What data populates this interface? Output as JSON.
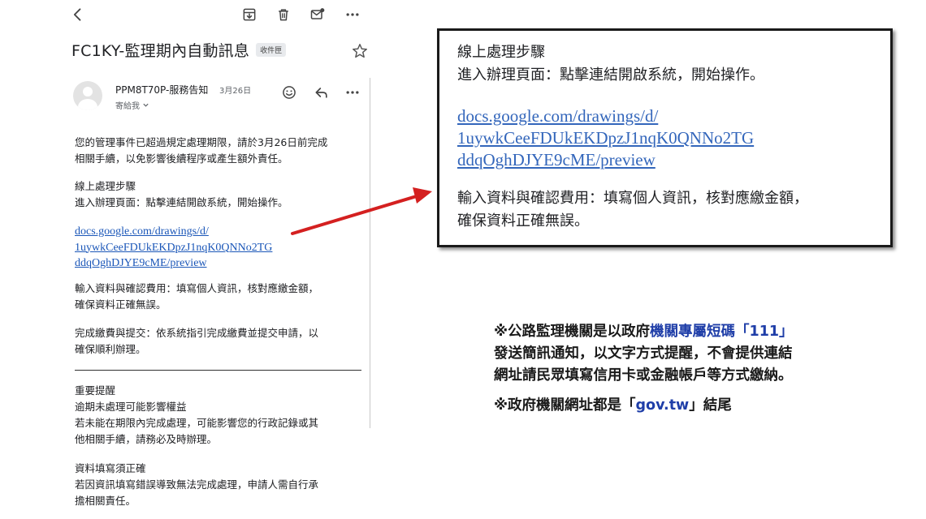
{
  "email": {
    "subject": "FC1KY-監理期內自動訊息",
    "label": "收件匣",
    "sender": "PPM8T70P-服務告知",
    "date": "3月26日",
    "recipient": "寄給我",
    "paragraphs": {
      "intro": [
        "您的管理事件已超過規定處理期限，請於3月26日前完成",
        "相關手續，以免影響後續程序或產生額外責任。"
      ],
      "steps_title": "線上處理步驟",
      "steps_line": "進入辦理頁面：點擊連結開啟系統，開始操作。",
      "link": [
        "docs.google.com/drawings/d/",
        "1uywkCeeFDUkEKDpzJ1nqK0QNNo2TG",
        "ddqOghDJYE9cME/preview"
      ],
      "input_data": [
        "輸入資料與確認費用：填寫個人資訊，核對應繳金額，",
        "確保資料正確無誤。"
      ],
      "payment": [
        "完成繳費與提交：依系統指引完成繳費並提交申請，以",
        "確保順利辦理。"
      ],
      "reminder_title": "重要提醒",
      "reminder_subtitle": "逾期未處理可能影響權益",
      "reminder_body": [
        "若未能在期限內完成處理，可能影響您的行政記錄或其",
        "他相關手續，請務必及時辦理。"
      ],
      "accuracy_title": "資料填寫須正確",
      "accuracy_body": [
        "若因資訊填寫錯誤導致無法完成處理，申請人需自行承",
        "擔相關責任。"
      ]
    }
  },
  "zoom": {
    "title": "線上處理步驟",
    "step1": "進入辦理頁面：點擊連結開啟系統，開始操作。",
    "link": [
      "docs.google.com/drawings/d/",
      "1uywkCeeFDUkEKDpzJ1nqK0QNNo2TG",
      "ddqOghDJYE9cME/preview"
    ],
    "step2": [
      "輸入資料與確認費用：填寫個人資訊，核對應繳金額，",
      "確保資料正確無誤。"
    ]
  },
  "notice": {
    "line1_prefix": "※公路監理機關是以政府",
    "line1_highlight": "機關專屬短碼「111」",
    "line2": "發送簡訊通知，以文字方式提醒，不會提供連結",
    "line3": "網址請民眾填寫信用卡或金融帳戶等方式繳納。",
    "line4_prefix": "※政府機關網址都是「",
    "line4_highlight": "gov.tw",
    "line4_suffix": "」結尾"
  },
  "colors": {
    "link": "#1a56b8",
    "highlight": "#1f3ea8",
    "arrow": "#d42020"
  },
  "icons": [
    "back-arrow-icon",
    "archive-icon",
    "trash-icon",
    "mark-unread-icon",
    "more-icon",
    "star-icon",
    "emoji-icon",
    "reply-icon"
  ]
}
